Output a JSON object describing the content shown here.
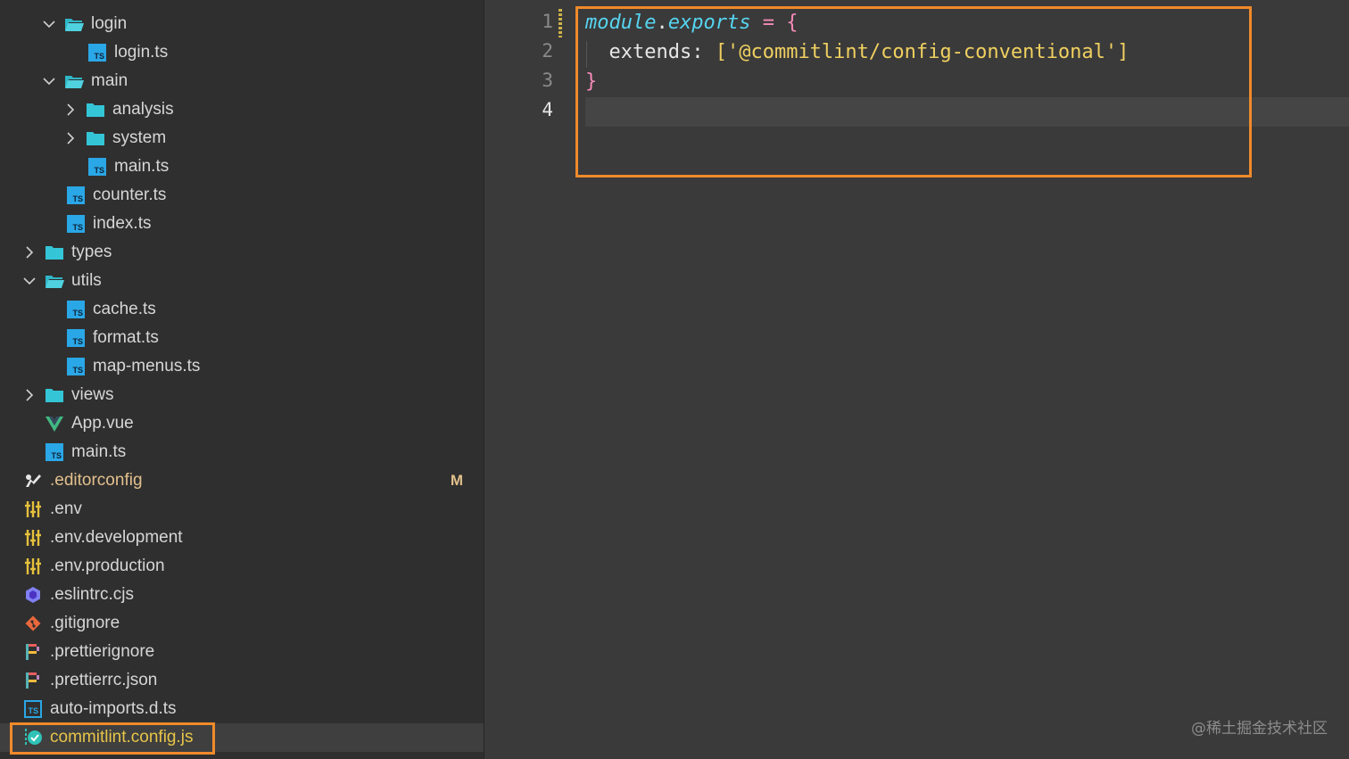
{
  "explorer": {
    "items": [
      {
        "label": "login",
        "icon": "folder-open-icon",
        "kind": "folder-open"
      },
      {
        "label": "login.ts",
        "icon": "typescript-file-icon",
        "kind": "ts"
      },
      {
        "label": "main",
        "icon": "folder-open-icon",
        "kind": "folder-open"
      },
      {
        "label": "analysis",
        "icon": "folder-icon",
        "kind": "folder"
      },
      {
        "label": "system",
        "icon": "folder-icon",
        "kind": "folder"
      },
      {
        "label": "main.ts",
        "icon": "typescript-file-icon",
        "kind": "ts"
      },
      {
        "label": "counter.ts",
        "icon": "typescript-file-icon",
        "kind": "ts"
      },
      {
        "label": "index.ts",
        "icon": "typescript-file-icon",
        "kind": "ts"
      },
      {
        "label": "types",
        "icon": "folder-icon",
        "kind": "folder"
      },
      {
        "label": "utils",
        "icon": "folder-open-icon",
        "kind": "folder-open"
      },
      {
        "label": "cache.ts",
        "icon": "typescript-file-icon",
        "kind": "ts"
      },
      {
        "label": "format.ts",
        "icon": "typescript-file-icon",
        "kind": "ts"
      },
      {
        "label": "map-menus.ts",
        "icon": "typescript-file-icon",
        "kind": "ts"
      },
      {
        "label": "views",
        "icon": "folder-icon",
        "kind": "folder"
      },
      {
        "label": "App.vue",
        "icon": "vue-file-icon",
        "kind": "vue"
      },
      {
        "label": "main.ts",
        "icon": "typescript-file-icon",
        "kind": "ts"
      },
      {
        "label": ".editorconfig",
        "icon": "editorconfig-icon",
        "kind": "editorconfig",
        "badge": "M"
      },
      {
        "label": ".env",
        "icon": "env-settings-icon",
        "kind": "env"
      },
      {
        "label": ".env.development",
        "icon": "env-settings-icon",
        "kind": "env"
      },
      {
        "label": ".env.production",
        "icon": "env-settings-icon",
        "kind": "env"
      },
      {
        "label": ".eslintrc.cjs",
        "icon": "eslint-icon",
        "kind": "eslint"
      },
      {
        "label": ".gitignore",
        "icon": "git-icon",
        "kind": "git"
      },
      {
        "label": ".prettierignore",
        "icon": "prettier-icon",
        "kind": "prettier"
      },
      {
        "label": ".prettierrc.json",
        "icon": "prettier-icon",
        "kind": "prettier"
      },
      {
        "label": "auto-imports.d.ts",
        "icon": "typescript-def-icon",
        "kind": "tsdef"
      },
      {
        "label": "commitlint.config.js",
        "icon": "commitlint-icon",
        "kind": "commitlint",
        "selected": true
      }
    ]
  },
  "editor": {
    "line_numbers": [
      "1",
      "2",
      "3",
      "4"
    ],
    "active_line": "4",
    "lines": {
      "l1": {
        "module": "module",
        "dot": ".",
        "exports": "exports",
        "eq": " = ",
        "brace": "{"
      },
      "l2": {
        "indent": "  ",
        "key": "extends",
        "colon": ": ",
        "open": "[",
        "string": "'@commitlint/config-conventional'",
        "close": "]"
      },
      "l3": {
        "brace": "}"
      }
    }
  },
  "colors": {
    "highlight_box": "#f08a2a",
    "modified": "#e2c08d",
    "accent_file": "#e7c548"
  },
  "watermark": "@稀土掘金技术社区"
}
